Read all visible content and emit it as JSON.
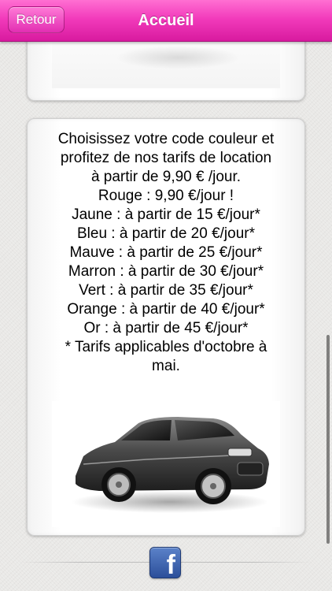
{
  "navbar": {
    "back_label": "Retour",
    "title": "Accueil"
  },
  "content": {
    "lines": [
      "Choisissez votre code couleur et",
      "profitez de nos tarifs de location",
      "à partir de 9,90 € /jour.",
      "Rouge : 9,90 €/jour !",
      "Jaune : à partir de 15 €/jour*",
      "Bleu : à partir de 20 €/jour*",
      "Mauve : à partir de 25 €/jour*",
      "Marron : à partir de 30 €/jour*",
      "Vert : à partir de 35 €/jour*",
      "Orange : à partir de 40 €/jour*",
      "Or : à partir de 45 €/jour*",
      "* Tarifs applicables d'octobre à",
      "mai."
    ]
  },
  "footer": {
    "facebook_glyph": "f"
  },
  "icons": {
    "facebook": "facebook-icon",
    "car": "car-image"
  },
  "colors": {
    "navbar_pink": "#f23bbb",
    "facebook_blue": "#3b5998"
  }
}
